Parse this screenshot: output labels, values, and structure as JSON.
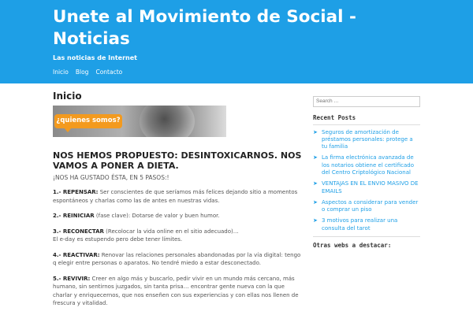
{
  "header": {
    "title_line1": "Unete al Movimiento de Social -",
    "title_line2": "Noticias",
    "description": "Las noticias de Internet",
    "nav": [
      "Inicio",
      "Blog",
      "Contacto"
    ]
  },
  "main": {
    "page_title": "Inicio",
    "banner_text": "¿quienes somos?",
    "heading": "NOS HEMOS PROPUESTO: DESINTOXICARNOS. NOS VAMOS A PONER A DIETA.",
    "intro": "¡NOS HA GUSTADO ÉSTA, EN 5 PASOS:!",
    "steps": [
      {
        "label": "1.- REPENSAR:",
        "text": " Ser conscientes de que seríamos más felices dejando sitio a momentos espontáneos y charlas como las de antes en nuestras vidas."
      },
      {
        "label": "2.- REINICIAR",
        "text": " (fase clave): Dotarse de valor y buen humor."
      },
      {
        "label": "3.- RECONECTAR",
        "text": " (Recolocar la vida online en el sitio adecuado)…",
        "line2": "El e-day es estupendo pero debe tener límites."
      },
      {
        "label": "4.- REACTIVAR:",
        "text": " Renovar las relaciones personales abandonadas por la vía digital: tengo q elegir entre personas o aparatos. No tendré miedo a estar desconectado."
      },
      {
        "label": "5.- REVIVIR:",
        "text": " Creer en algo más y buscarlo, pedir vivir en un mundo más cercano, más humano, sin sentirnos juzgados, sin tanta prisa… encontrar gente nueva con la que charlar y enriquecernos, que nos enseñen con sus experiencias y con ellas nos llenen de frescura y vitalidad."
      }
    ]
  },
  "sidebar": {
    "search_placeholder": "Search …",
    "recent_title": "Recent Posts",
    "recent_posts": [
      "Seguros de amortización de préstamos personales: protege a tu familia",
      "La firma electrónica avanzada de los notarios obtiene el certificado del Centro Criptológico Nacional",
      "VENTAJAS EN EL ENVIO MASIVO DE EMAILS",
      "Aspectos a considerar para vender o comprar un piso",
      "3 motivos para realizar una consulta del tarot"
    ],
    "other_title": "Otras webs a destacar:"
  },
  "colors": {
    "accent": "#1e9fe6",
    "banner_orange": "#f39a1e"
  }
}
